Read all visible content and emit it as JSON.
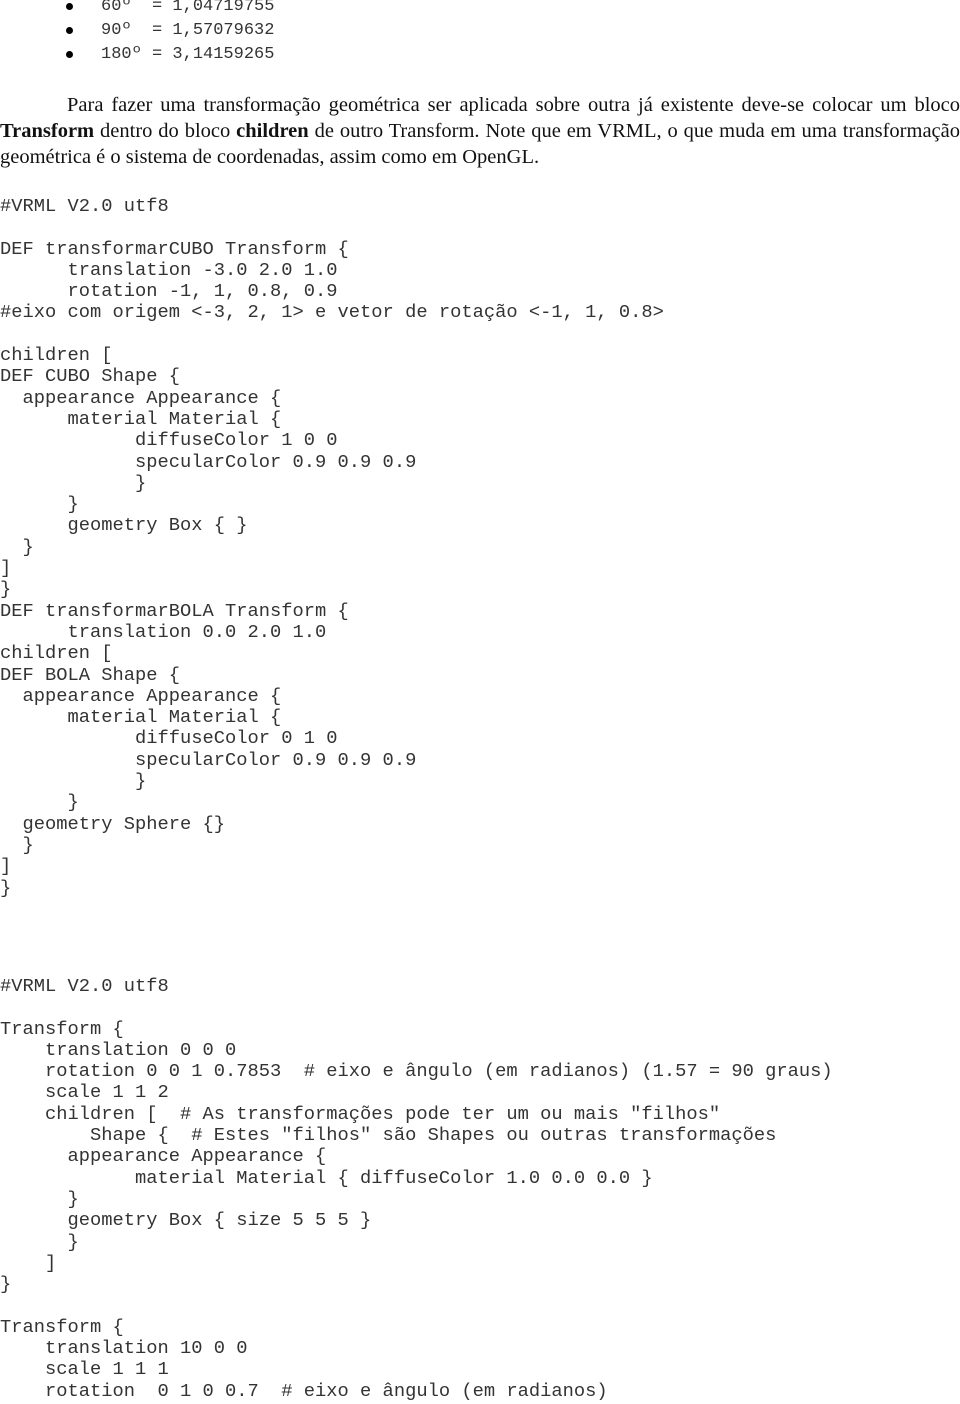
{
  "bullets": [
    "60º  = 1,04719755",
    "90º  = 1,57079632",
    "180º = 3,14159265"
  ],
  "paragraph": {
    "part1": "Para fazer uma transformação geométrica ser aplicada sobre outra já existente deve-se colocar um bloco ",
    "bold1": "Transform",
    "part2": " dentro do bloco ",
    "bold2": "children",
    "part3": " de outro Transform. Note que em VRML, o que muda em uma transformação geométrica é o sistema de coordenadas, assim como em OpenGL."
  },
  "code_block_1": [
    "#VRML V2.0 utf8",
    "",
    "DEF transformarCUBO Transform {",
    "      translation -3.0 2.0 1.0",
    "      rotation -1, 1, 0.8, 0.9",
    "#eixo com origem <-3, 2, 1> e vetor de rotação <-1, 1, 0.8>",
    "",
    "children [",
    "DEF CUBO Shape {",
    "  appearance Appearance {",
    "      material Material {",
    "            diffuseColor 1 0 0",
    "            specularColor 0.9 0.9 0.9",
    "            }",
    "      }",
    "      geometry Box { }",
    "  }",
    "]",
    "}",
    "DEF transformarBOLA Transform {",
    "      translation 0.0 2.0 1.0",
    "children [",
    "DEF BOLA Shape {",
    "  appearance Appearance {",
    "      material Material {",
    "            diffuseColor 0 1 0",
    "            specularColor 0.9 0.9 0.9",
    "            }",
    "      }",
    "  geometry Sphere {}",
    "  }",
    "]",
    "}"
  ],
  "code_block_2": [
    "#VRML V2.0 utf8",
    "",
    "Transform {",
    "    translation 0 0 0",
    "    rotation 0 0 1 0.7853  # eixo e ângulo (em radianos) (1.57 = 90 graus)",
    "    scale 1 1 2",
    "    children [  # As transformações pode ter um ou mais \"filhos\"",
    "        Shape {  # Estes \"filhos\" são Shapes ou outras transformações",
    "      appearance Appearance {",
    "            material Material { diffuseColor 1.0 0.0 0.0 }",
    "      }",
    "      geometry Box { size 5 5 5 }",
    "      }",
    "    ]",
    "}",
    "",
    "Transform {",
    "    translation 10 0 0",
    "    scale 1 1 1",
    "    rotation  0 1 0 0.7  # eixo e ângulo (em radianos)"
  ]
}
